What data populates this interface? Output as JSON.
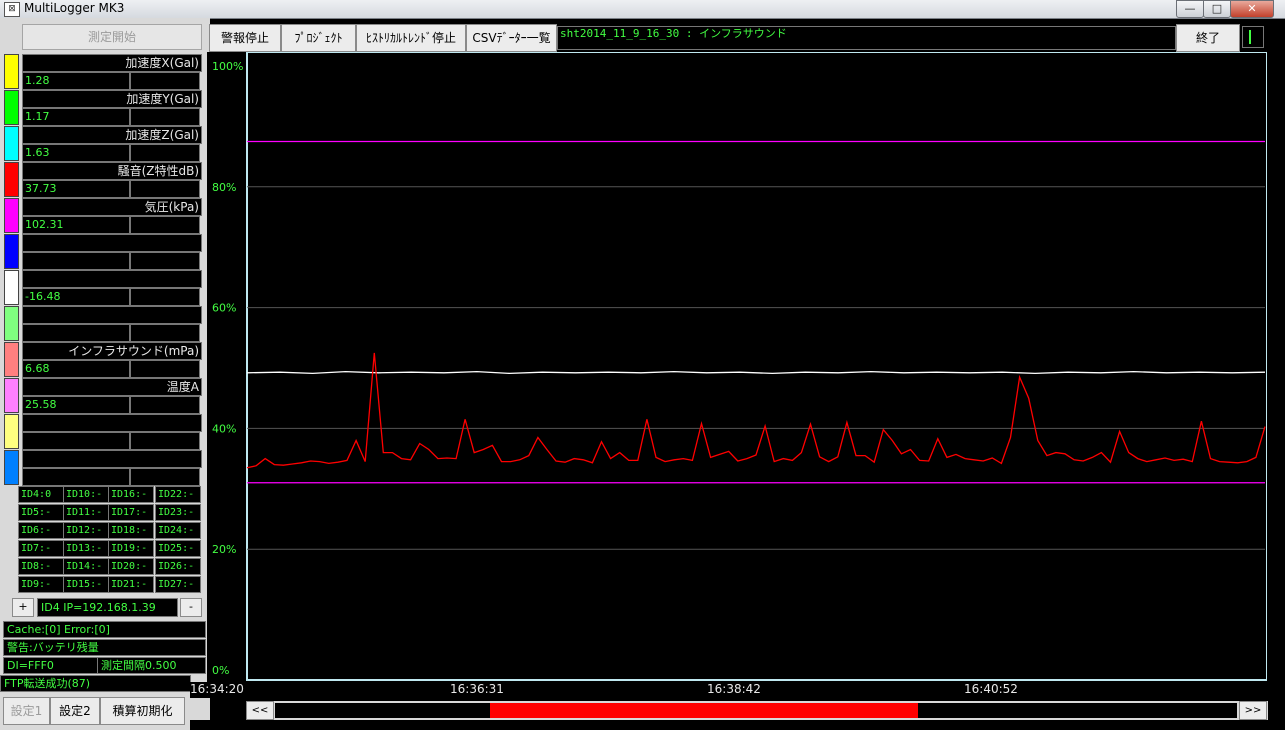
{
  "window": {
    "title": "MultiLogger MK3",
    "minimize": "—",
    "maximize": "□",
    "close": "✕"
  },
  "left_panel": {
    "measure_start": "測定開始",
    "channels": [
      {
        "label": "加速度X(Gal)",
        "value": "1.28",
        "color": "#ffff00"
      },
      {
        "label": "加速度Y(Gal)",
        "value": "1.17",
        "color": "#00ff00"
      },
      {
        "label": "加速度Z(Gal)",
        "value": "1.63",
        "color": "#00ffff"
      },
      {
        "label": "騒音(Z特性dB)",
        "value": "37.73",
        "color": "#ff0000"
      },
      {
        "label": "気圧(kPa)",
        "value": "102.31",
        "color": "#ff00ff"
      },
      {
        "label": "",
        "value": "",
        "color": "#0000ff"
      },
      {
        "label": "",
        "value": "-16.48",
        "color": "#ffffff"
      },
      {
        "label": "",
        "value": "",
        "color": "#80ff80"
      },
      {
        "label": "インフラサウンド(mPa)",
        "value": "6.68",
        "color": "#ff8080"
      },
      {
        "label": "温度A",
        "value": "25.58",
        "color": "#ff80ff"
      },
      {
        "label": "",
        "value": "",
        "color": "#ffff80"
      },
      {
        "label": "",
        "value": "",
        "color": "#0080ff"
      }
    ],
    "ids": [
      [
        "ID4:0",
        "ID10:-",
        "ID16:-",
        "ID22:-"
      ],
      [
        "ID5:-",
        "ID11:-",
        "ID17:-",
        "ID23:-"
      ],
      [
        "ID6:-",
        "ID12:-",
        "ID18:-",
        "ID24:-"
      ],
      [
        "ID7:-",
        "ID13:-",
        "ID19:-",
        "ID25:-"
      ],
      [
        "ID8:-",
        "ID14:-",
        "ID20:-",
        "ID26:-"
      ],
      [
        "ID9:-",
        "ID15:-",
        "ID21:-",
        "ID27:-"
      ]
    ],
    "plus": "+",
    "minus": "-",
    "ip": "ID4 IP=192.168.1.39",
    "cache": "Cache:[0] Error:[0]",
    "warning": "警告:バッテリ残量",
    "di": "DI=FFF0",
    "interval": "測定間隔0.500",
    "ftp": "FTP転送成功(87)",
    "settings1": "設定1",
    "settings2": "設定2",
    "reset": "積算初期化"
  },
  "toolbar": {
    "alarm_stop": "警報停止",
    "project": "ﾌﾟﾛｼﾞｪｸﾄ",
    "history_stop": "ﾋｽﾄﾘｶﾙﾄﾚﾝﾄﾞ停止",
    "csv_list": "CSVﾃﾞｰﾀｰ一覧",
    "file_name": "sht2014_11_9_16_30 : インフラサウンド",
    "exit": "終了"
  },
  "chart_data": {
    "type": "line",
    "y_ticks": [
      "100%",
      "80%",
      "60%",
      "40%",
      "20%",
      "0%"
    ],
    "ylim": [
      0,
      100
    ],
    "x_ticks": [
      "16:34:20",
      "16:36:31",
      "16:38:42",
      "16:40:52"
    ],
    "grid": true,
    "reference_lines": [
      {
        "value": 87.5,
        "color": "#ff00ff"
      },
      {
        "value": 31,
        "color": "#ff00ff"
      }
    ],
    "series": [
      {
        "color": "#ffffff",
        "values": [
          49.2,
          49.3,
          49.1,
          49.4,
          49.2,
          49.3,
          49.2,
          49.4,
          49.1,
          49.3,
          49.2,
          49.3,
          49.2,
          49.4,
          49.2,
          49.3,
          49.1,
          49.3,
          49.2,
          49.4,
          49.2,
          49.3,
          49.2,
          49.3,
          49.1,
          49.3,
          49.2,
          49.4,
          49.2,
          49.3,
          49.2,
          49.3
        ]
      },
      {
        "color": "#ff0000",
        "values": [
          33.5,
          33.8,
          35,
          34,
          33.9,
          34.1,
          34.3,
          34.6,
          34.5,
          34.2,
          34.4,
          34.7,
          38,
          34.5,
          52.5,
          36,
          36,
          35,
          34.8,
          37.5,
          36.5,
          35,
          35.1,
          35,
          41.5,
          36,
          36.5,
          37.2,
          34.5,
          34.5,
          34.8,
          35.5,
          38.5,
          36.5,
          34.6,
          34.4,
          35,
          34.8,
          34.3,
          37.8,
          35,
          36,
          34.7,
          34.7,
          41.5,
          35.2,
          34.5,
          34.8,
          35,
          34.7,
          40.8,
          35.2,
          35.7,
          36.2,
          34.6,
          35,
          35.6,
          40.4,
          34.5,
          35,
          34.7,
          36,
          40.7,
          35.3,
          34.5,
          35.3,
          41,
          35.5,
          35.5,
          34.4,
          39.8,
          38,
          35.8,
          36.5,
          34.7,
          34.6,
          38.3,
          35.2,
          35.7,
          35,
          34.8,
          34.6,
          35.1,
          34.2,
          38.5,
          48.5,
          45,
          38,
          35.5,
          36,
          35.8,
          34.8,
          34.6,
          35.2,
          36,
          34.4,
          39.5,
          36,
          35,
          34.5,
          34.8,
          35.1,
          34.7,
          34.9,
          34.5,
          41.2,
          35,
          34.5,
          34.4,
          34.3,
          34.5,
          35.2,
          40.3
        ]
      }
    ]
  }
}
